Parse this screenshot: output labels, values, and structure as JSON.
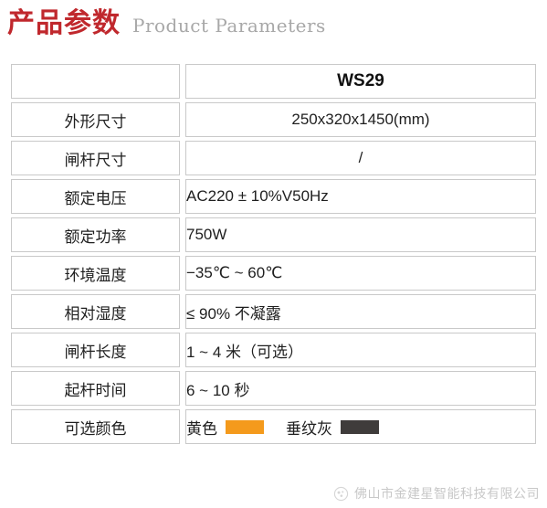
{
  "header": {
    "title_cn": "产品参数",
    "title_en": "Product Parameters",
    "accent_color": "#c0282d",
    "subtitle_color": "#a8a8a8"
  },
  "table": {
    "header_row": {
      "label": "",
      "value": "WS29"
    },
    "rows": [
      {
        "label": "外形尺寸",
        "value": "250x320x1450(mm)",
        "align": "center"
      },
      {
        "label": "闸杆尺寸",
        "value": "/",
        "align": "center"
      },
      {
        "label": "额定电压",
        "value": "AC220 ± 10%V50Hz",
        "align": "left"
      },
      {
        "label": "额定功率",
        "value": "750W",
        "align": "left"
      },
      {
        "label": "环境温度",
        "value": "−35℃ ~ 60℃",
        "align": "left"
      },
      {
        "label": "相对湿度",
        "value": "≤ 90% 不凝露",
        "align": "left"
      },
      {
        "label": "闸杆长度",
        "value": "1 ~ 4 米（可选）",
        "align": "left"
      },
      {
        "label": "起杆时间",
        "value": "6 ~ 10 秒",
        "align": "left"
      }
    ],
    "color_row": {
      "label": "可选颜色",
      "colors": [
        {
          "name": "黄色",
          "hex": "#f49a1c"
        },
        {
          "name": "垂纹灰",
          "hex": "#3f3c3b"
        }
      ]
    },
    "border_color": "#c9c9c9"
  },
  "footer": {
    "watermark_text": "佛山市金建星智能科技有限公司",
    "watermark_color": "#c8c8c8",
    "logo_icon": "company-logo-icon"
  }
}
